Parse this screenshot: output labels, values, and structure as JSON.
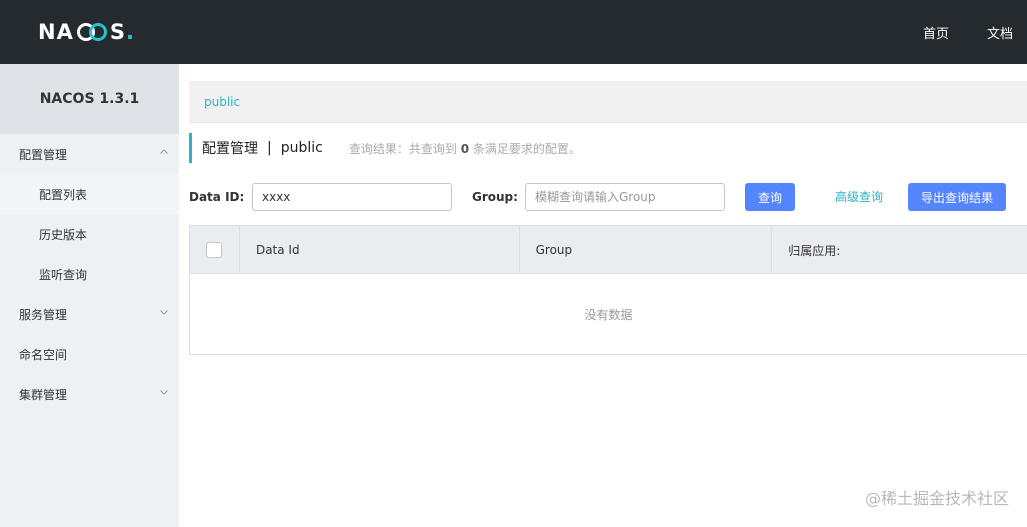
{
  "header": {
    "logo_text_left": "NA",
    "logo_text_right": "S",
    "logo_dot": ".",
    "nav": [
      {
        "label": "首页"
      },
      {
        "label": "文档"
      }
    ]
  },
  "sidebar": {
    "version": "NACOS 1.3.1",
    "items": [
      {
        "label": "配置管理"
      },
      {
        "label": "配置列表"
      },
      {
        "label": "历史版本"
      },
      {
        "label": "监听查询"
      },
      {
        "label": "服务管理"
      },
      {
        "label": "命名空间"
      },
      {
        "label": "集群管理"
      }
    ]
  },
  "breadcrumb": {
    "namespace": "public"
  },
  "title": {
    "main": "配置管理",
    "separator": "|",
    "namespace": "public",
    "result_prefix": "查询结果：共查询到",
    "result_count": "0",
    "result_suffix": "条满足要求的配置。"
  },
  "search": {
    "dataid_label": "Data ID:",
    "dataid_value": "xxxx",
    "group_label": "Group:",
    "group_placeholder": "模糊查询请输入Group",
    "query_button": "查询",
    "advanced_link": "高级查询",
    "export_button": "导出查询结果"
  },
  "table": {
    "columns": [
      "Data Id",
      "Group",
      "归属应用:"
    ],
    "empty_text": "没有数据"
  },
  "watermark": "@稀土掘金技术社区",
  "colors": {
    "topbar": "#252a2f",
    "accent": "#2bb1c9",
    "primary_button": "#5584ff"
  }
}
